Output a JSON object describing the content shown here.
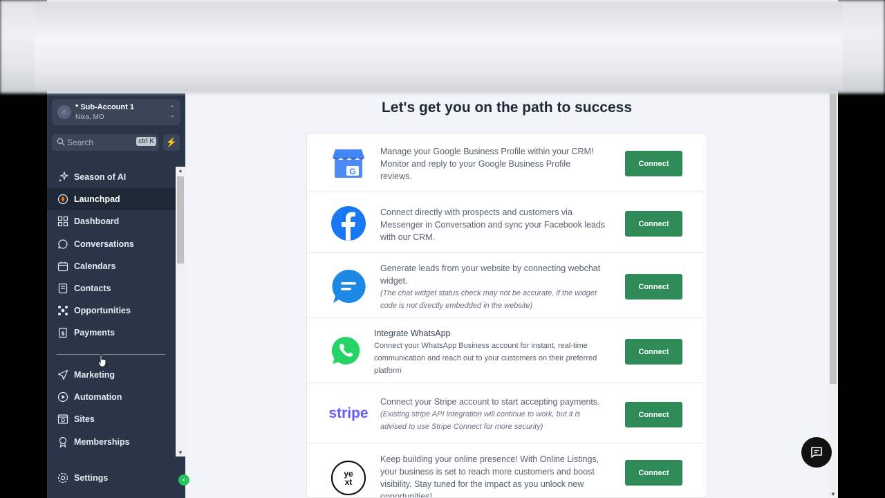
{
  "account": {
    "name": "* Sub-Account 1",
    "location": "Nixa, MO"
  },
  "search": {
    "placeholder": "Search",
    "shortcut": "ctrl K"
  },
  "nav": {
    "primary": [
      {
        "label": "Season of AI",
        "icon": "sparkle-icon"
      },
      {
        "label": "Launchpad",
        "icon": "rocket-icon",
        "active": true
      },
      {
        "label": "Dashboard",
        "icon": "grid-icon"
      },
      {
        "label": "Conversations",
        "icon": "chat-bubble-icon"
      },
      {
        "label": "Calendars",
        "icon": "calendar-icon"
      },
      {
        "label": "Contacts",
        "icon": "contacts-icon"
      },
      {
        "label": "Opportunities",
        "icon": "opportunities-icon"
      },
      {
        "label": "Payments",
        "icon": "payments-icon"
      }
    ],
    "secondary": [
      {
        "label": "Marketing",
        "icon": "send-icon"
      },
      {
        "label": "Automation",
        "icon": "automation-icon"
      },
      {
        "label": "Sites",
        "icon": "sites-icon"
      },
      {
        "label": "Memberships",
        "icon": "membership-icon"
      }
    ],
    "settings": "Settings"
  },
  "main": {
    "heading": "Let's get you on the path to success",
    "integrations": [
      {
        "id": "google",
        "text": "Manage your Google Business Profile within your CRM! Monitor and reply to your Google Business Profile reviews.",
        "button": "Connect"
      },
      {
        "id": "facebook",
        "text": "Connect directly with prospects and customers via Messenger in Conversation and sync your Facebook leads with our CRM.",
        "button": "Connect"
      },
      {
        "id": "webchat",
        "text": "Generate leads from your website by connecting webchat widget.",
        "note": "(The chat widget status check may not be accurate, if the widget code is not directly embedded in the website)",
        "button": "Connect"
      },
      {
        "id": "whatsapp",
        "title": "Integrate WhatsApp",
        "text": "Connect your WhatsApp Business account for instant, real-time communication and reach out to your customers on their preferred platform",
        "button": "Connect"
      },
      {
        "id": "stripe",
        "logo_text": "stripe",
        "text": "Connect your Stripe account to start accepting payments.",
        "note": "(Existing stripe API integration will continue to work, but it is advised to use Stripe Connect for more security)",
        "button": "Connect"
      },
      {
        "id": "yext",
        "logo_text": "ye xt",
        "text": "Keep building your online presence! With Online Listings, your business is set to reach more customers and boost visibility. Stay tuned for the impact as you unlock new opportunities!",
        "button": "Connect"
      }
    ]
  },
  "colors": {
    "sidebar": "#2a3647",
    "accent_green": "#2e8b57",
    "facebook": "#1877f2",
    "whatsapp": "#25d366",
    "stripe": "#635bff"
  }
}
